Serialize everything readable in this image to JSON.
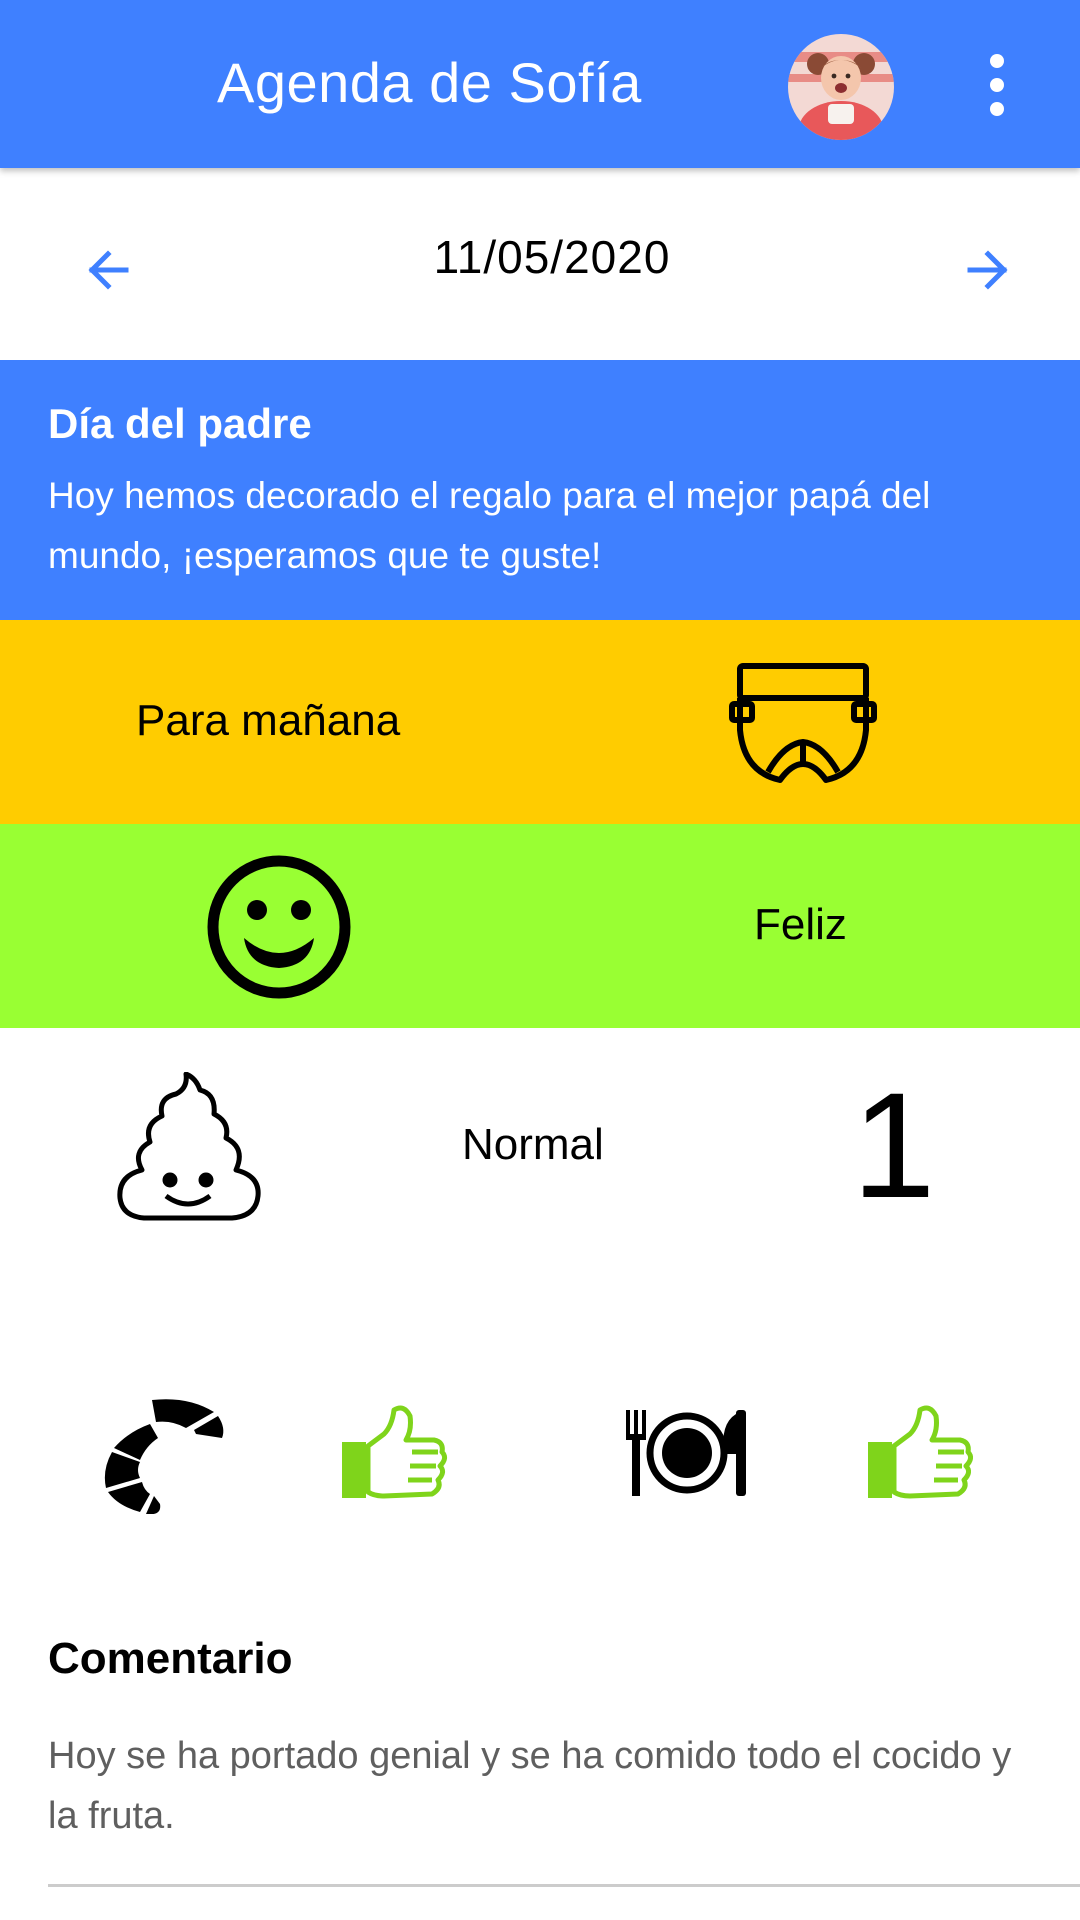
{
  "appbar": {
    "title": "Agenda de Sofía",
    "color": "#3f80ff",
    "avatar_icon": "child-photo",
    "menu_icon": "more-vertical-icon"
  },
  "date_nav": {
    "date": "11/05/2020",
    "prev_icon": "arrow-left-icon",
    "next_icon": "arrow-right-icon"
  },
  "notice": {
    "title": "Día del padre",
    "body": "Hoy hemos decorado el regalo para el mejor papá del mundo, ¡esperamos que te guste!"
  },
  "tomorrow": {
    "label": "Para mañana",
    "icon": "diaper-icon",
    "color": "#ffcc00"
  },
  "mood": {
    "label": "Feliz",
    "icon": "smiley-icon",
    "color": "#99ff33"
  },
  "stool": {
    "label": "Normal",
    "count": "1",
    "icon": "poop-icon"
  },
  "meals": [
    {
      "meal_icon": "croissant-icon",
      "rating_icon": "thumbs-up-icon"
    },
    {
      "meal_icon": "plate-cutlery-icon",
      "rating_icon": "thumbs-up-icon"
    }
  ],
  "comment": {
    "title": "Comentario",
    "body": "Hoy se ha portado genial y se ha comido todo el cocido y la fruta."
  }
}
